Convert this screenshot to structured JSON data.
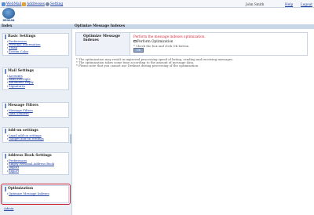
{
  "topbar": {
    "webmail": "WebMail",
    "addresses": "Addresses",
    "setting": "Setting",
    "user": "John Smith",
    "help": "Help",
    "logout": "Logout",
    "icons": [
      "mail-icon",
      "address-book-icon",
      "gear-icon"
    ]
  },
  "logo": {
    "text": "DENSAN"
  },
  "sidebar": {
    "header": "Index",
    "sections": [
      {
        "title": "Basic Settings",
        "links": [
          "Preferences",
          "Personal Information",
          "Trash",
          "Screen Color"
        ]
      },
      {
        "title": "Mail Settings",
        "links": [
          "Accounts",
          "Read Receipts",
          "Automatic Reply",
          "Signatures"
        ]
      },
      {
        "title": "Message Filters",
        "links": [
          "Message Filters",
          "Junk Senders"
        ]
      },
      {
        "title": "Add-on settings",
        "links": [
          "Lmail add-on settings",
          "Gadget add-on settings"
        ]
      },
      {
        "title": "Address Book Settings",
        "links": [
          "Preferences",
          "Empty Personal Address Book",
          "Import",
          "Export"
        ]
      },
      {
        "title": "Optimization",
        "links": [
          "Optimize Message Indexes"
        ]
      }
    ],
    "admin": "Admin"
  },
  "main": {
    "header": "Optimize Message Indexes",
    "label": "Optimize Message Indexes",
    "description": "Perform the message indexes optimization.",
    "checkbox_label": "Perform Optimization",
    "hint": "* Check the box and click OK button.",
    "button": "OK",
    "notes": [
      "* The optimization may result in improved processing speed of listing, sending and receiving messages.",
      "* The optimization takes some time according to the amount of message data.",
      "* Please note that you cannot use Desknet during processing of the optimization."
    ]
  },
  "colors": {
    "accent": "#1a3c9e",
    "highlight": "#d0283a",
    "header_bg": "#c9d6e8"
  }
}
